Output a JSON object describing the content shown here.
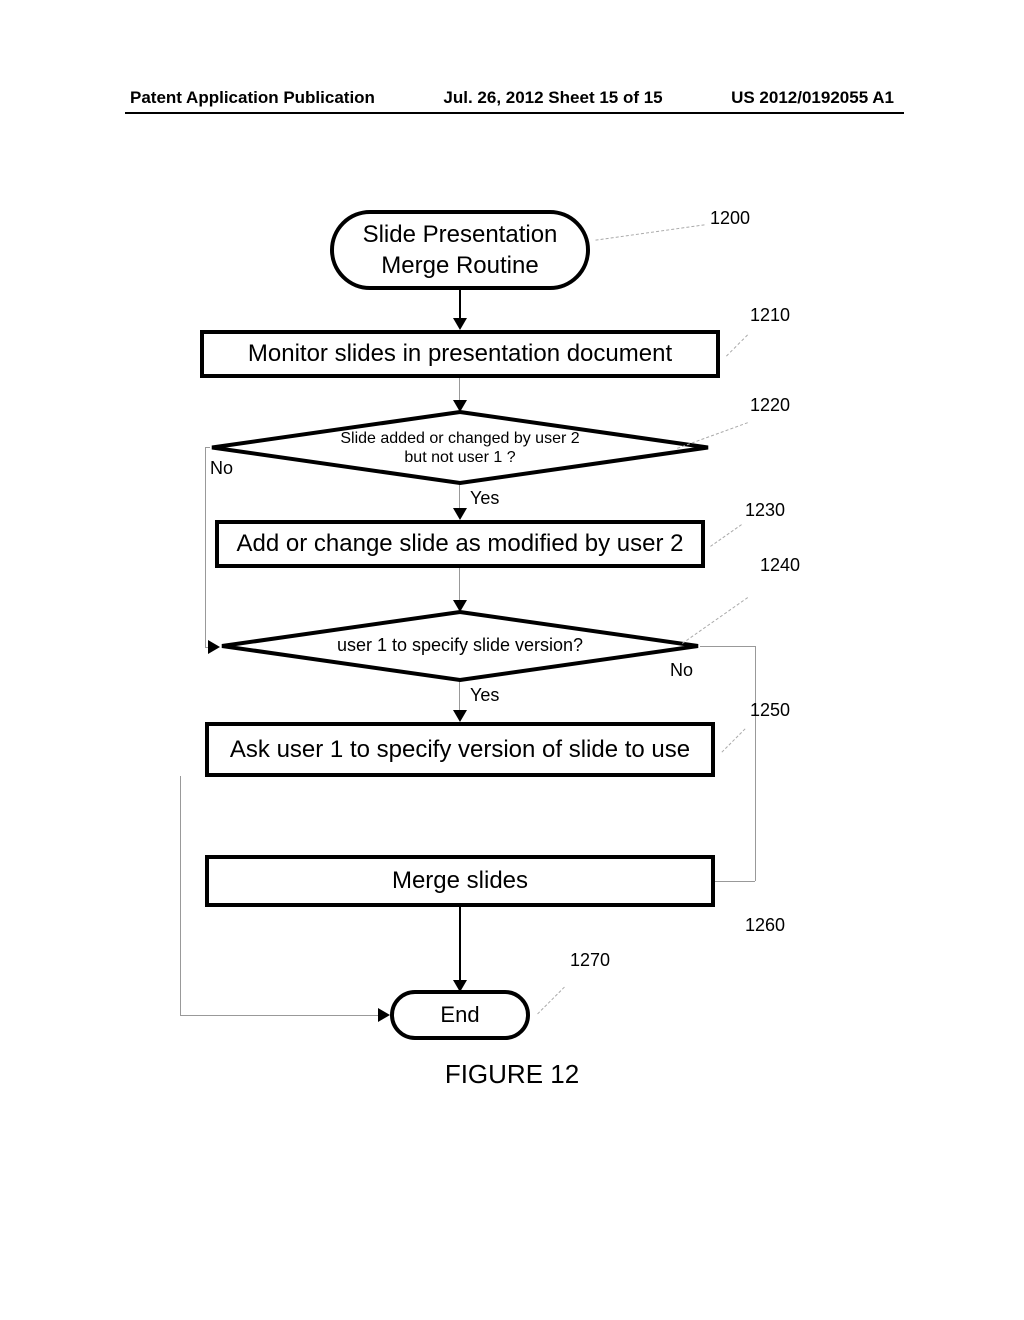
{
  "header": {
    "left": "Patent Application Publication",
    "center": "Jul. 26, 2012  Sheet 15 of 15",
    "right": "US 2012/0192055 A1"
  },
  "nodes": {
    "start": "Slide Presentation\nMerge Routine",
    "monitor": "Monitor slides in presentation document",
    "decision1_line1": "Slide added or changed by user 2",
    "decision1_line2": "but not user 1 ?",
    "add_change": "Add or change slide as modified by user 2",
    "decision2": "user 1 to specify slide version?",
    "ask_user": "Ask user 1 to specify version of slide to use",
    "merge": "Merge  slides",
    "end": "End"
  },
  "refs": {
    "r1200": "1200",
    "r1210": "1210",
    "r1220": "1220",
    "r1230": "1230",
    "r1240": "1240",
    "r1250": "1250",
    "r1260": "1260",
    "r1270": "1270"
  },
  "labels": {
    "no": "No",
    "yes": "Yes"
  },
  "caption": "FIGURE 12"
}
